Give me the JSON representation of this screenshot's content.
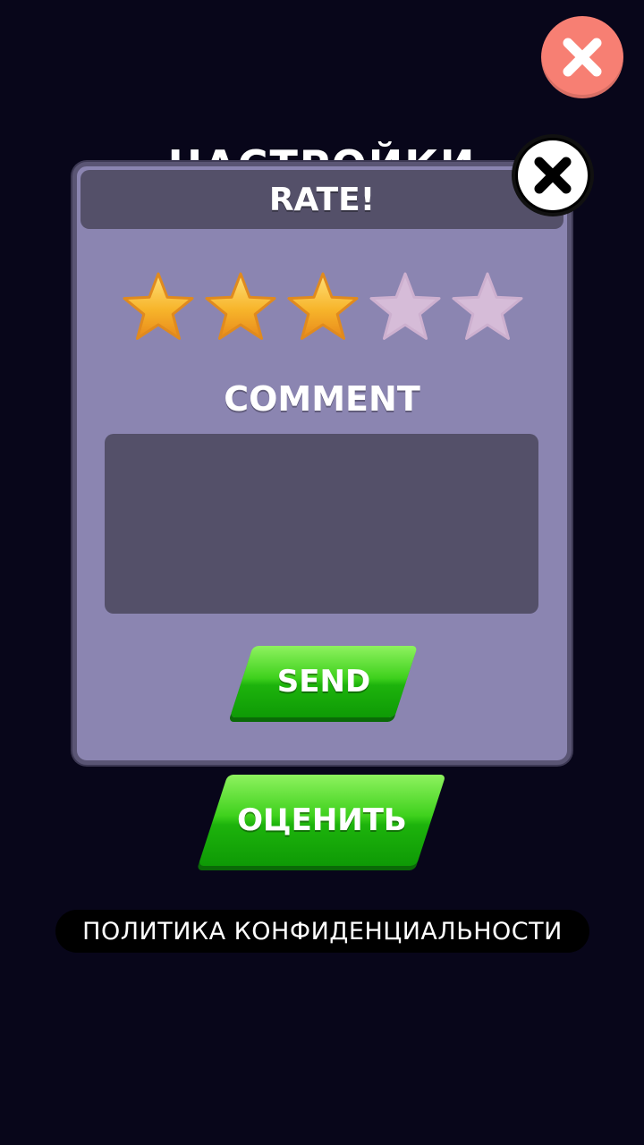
{
  "background_title": "НАСТРОЙКИ",
  "dialog": {
    "title": "RATE!",
    "rating": 3,
    "max_rating": 5,
    "comment_label": "COMMENT",
    "comment_value": "",
    "send_label": "SEND"
  },
  "rate_button_label": "ОЦЕНИТЬ",
  "privacy_label": "ПОЛИТИКА КОНФИДЕНЦИАЛЬНОСТИ",
  "icons": {
    "close_top": "close-icon",
    "close_dialog": "close-icon",
    "star": "star-icon"
  },
  "colors": {
    "background": "#08061a",
    "dialog": "#8b85b1",
    "dialog_header": "#545069",
    "close_top": "#f77f73",
    "star_filled": "#f7b52b",
    "star_empty": "#d6bcd8",
    "button_green": "#3fd11d"
  }
}
